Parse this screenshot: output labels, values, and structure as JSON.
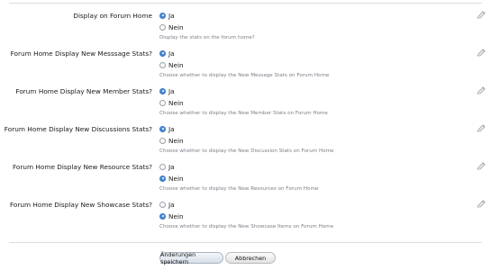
{
  "options": [
    {
      "label": "Display on Forum Home",
      "choice_yes": "Ja",
      "choice_no": "Nein",
      "selected": "Ja",
      "hint": "Display the stats on the forum home?"
    },
    {
      "label": "Forum Home Display New Messsage Stats?",
      "choice_yes": "Ja",
      "choice_no": "Nein",
      "selected": "Ja",
      "hint": "Choose whether to display the New Message Stats on Forum Home"
    },
    {
      "label": "Forum Home Display New Member Stats?",
      "choice_yes": "Ja",
      "choice_no": "Nein",
      "selected": "Ja",
      "hint": "Choose whether to display the New Member Stats on Forum Home"
    },
    {
      "label": "Forum Home Display New Discussions Stats?",
      "choice_yes": "Ja",
      "choice_no": "Nein",
      "selected": "Ja",
      "hint": "Choose whether to display the New Discussion Stats on Forum Home"
    },
    {
      "label": "Forum Home Display New Resource Stats?",
      "choice_yes": "Ja",
      "choice_no": "Nein",
      "selected": "Nein",
      "hint": "Choose whether to display the New Resources on Forum Home"
    },
    {
      "label": "Forum Home Display New Showcase Stats?",
      "choice_yes": "Ja",
      "choice_no": "Nein",
      "selected": "Nein",
      "hint": "Choose whether to display the New Showcase Items on Forum Home"
    }
  ],
  "buttons": {
    "save_label": "Änderungen speichern",
    "cancel_label": "Abbrechen"
  },
  "icons": {
    "edit": "pencil-edit-icon"
  },
  "colors": {
    "radio_selected": "#4a8ad6",
    "hint_text": "#7a7f86"
  }
}
